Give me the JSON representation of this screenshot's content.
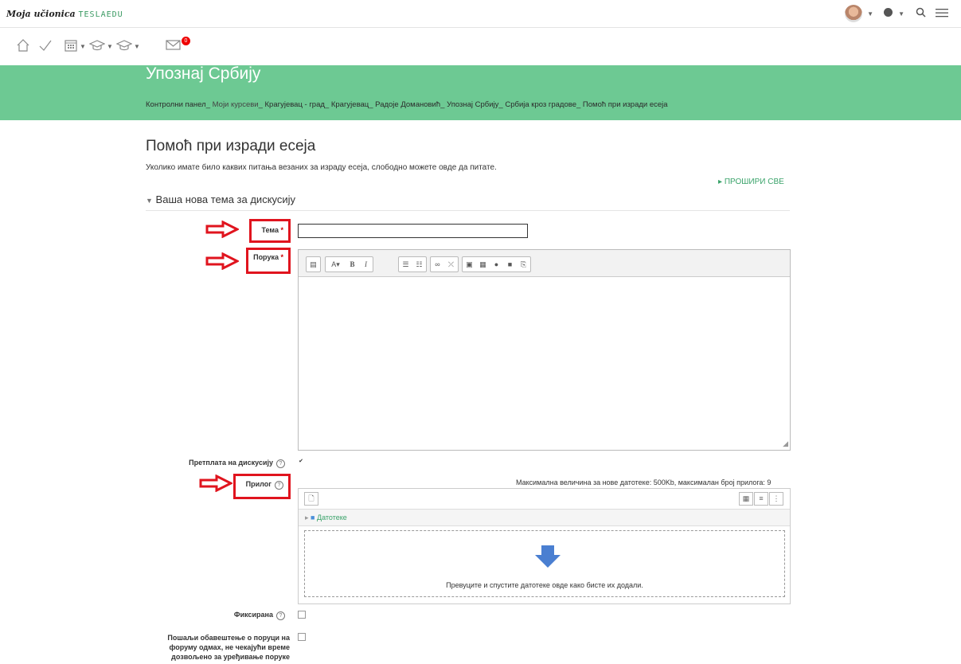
{
  "topbar": {
    "brand_script": "Moja učionica",
    "brand_logo": "TESLAEDU",
    "icons": [
      "user-avatar",
      "globe-icon",
      "search-icon",
      "menu-icon"
    ]
  },
  "navbar": {
    "icons": [
      "home-icon",
      "check-icon",
      "calendar-icon",
      "graduation-cap-icon",
      "graduation-cap-star-icon",
      "messages-icon"
    ],
    "messages_badge": "0"
  },
  "banner": {
    "course_title": "Упознај Србију",
    "breadcrumb": [
      "Контролни панел",
      "Моји курсеви",
      "Крагујевац - град",
      "Крагујевац",
      "Радоје Домановић",
      "Упознај Србију",
      "Србија кроз градове",
      "Помоћ при изради есеја"
    ],
    "separator": "_"
  },
  "forum": {
    "title": "Помоћ при изради есеја",
    "description": "Уколико имате било каквих питања везаних за израду есеја, слободно можете овде да питате.",
    "expand_all": "ПРОШИРИ СВЕ"
  },
  "form": {
    "section_title": "Ваша нова тема за дискусију",
    "subject_label": "Тема",
    "message_label": "Порука",
    "required_mark": "*",
    "subscribe_label": "Претплата на дискусију",
    "subscribe_checked": true,
    "attachment_label": "Прилог",
    "attachment_limits": "Максимална величина за нове датотеке: 500Kb, максималан број прилога: 9",
    "files_folder": "Датотеке",
    "dropzone_text": "Превуците и спустите датотеке овде како бисте их додали.",
    "pinned_label": "Фиксирана",
    "pinned_checked": false,
    "notify_label": "Пошаљи обавештење о поруци на форуму одмах, не чекајући време дозвољено за уређивање поруке",
    "notify_checked": false
  },
  "colors": {
    "banner": "#6dc993",
    "accent_green": "#3aa36a",
    "highlight_red": "#e0141e",
    "drop_arrow": "#4a7fd1"
  }
}
